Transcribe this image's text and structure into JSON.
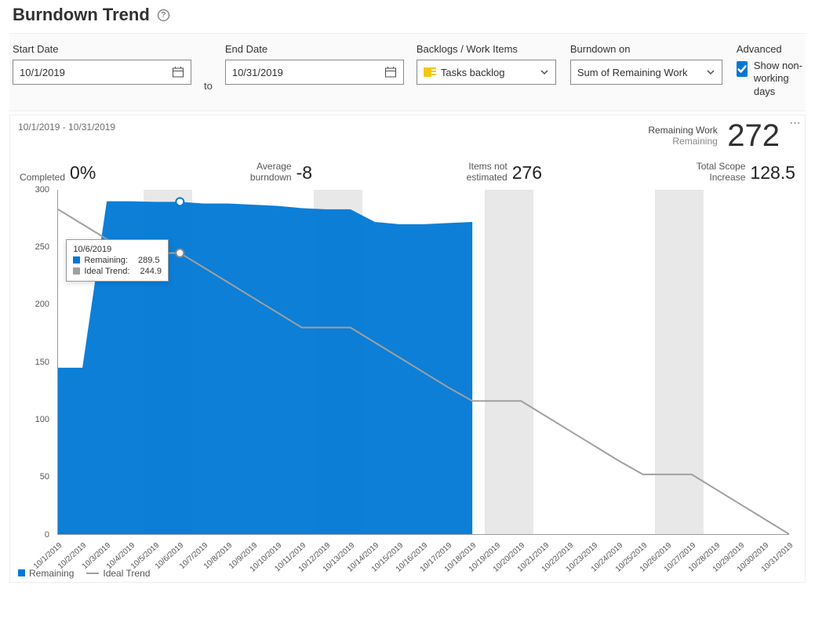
{
  "header": {
    "title": "Burndown Trend"
  },
  "controls": {
    "start_label": "Start Date",
    "start_value": "10/1/2019",
    "to_label": "to",
    "end_label": "End Date",
    "end_value": "10/31/2019",
    "backlogs_label": "Backlogs / Work Items",
    "backlogs_value": "Tasks backlog",
    "burndown_label": "Burndown on",
    "burndown_value": "Sum of Remaining Work",
    "advanced_label": "Advanced",
    "show_nonworking_label": "Show non-working days"
  },
  "chart_header": {
    "range_text": "10/1/2019 - 10/31/2019",
    "remaining_work_label": "Remaining Work",
    "remaining_sub": "Remaining",
    "remaining_value": "272"
  },
  "kpis": {
    "completed_label": "Completed",
    "completed_value": "0%",
    "avg_label1": "Average",
    "avg_label2": "burndown",
    "avg_value": "-8",
    "items_label1": "Items not",
    "items_label2": "estimated",
    "items_value": "276",
    "scope_label1": "Total Scope",
    "scope_label2": "Increase",
    "scope_value": "128.5"
  },
  "legend": {
    "remaining": "Remaining",
    "ideal": "Ideal Trend"
  },
  "tooltip": {
    "date": "10/6/2019",
    "remaining_label": "Remaining:",
    "remaining_value": "289.5",
    "ideal_label": "Ideal Trend:",
    "ideal_value": "244.9"
  },
  "chart_data": {
    "type": "area",
    "title": "Burndown Trend",
    "ylabel": "",
    "ylim": [
      0,
      300
    ],
    "y_ticks": [
      0,
      50,
      100,
      150,
      200,
      250,
      300
    ],
    "categories": [
      "10/1/2019",
      "10/2/2019",
      "10/3/2019",
      "10/4/2019",
      "10/5/2019",
      "10/6/2019",
      "10/7/2019",
      "10/8/2019",
      "10/9/2019",
      "10/10/2019",
      "10/11/2019",
      "10/12/2019",
      "10/13/2019",
      "10/14/2019",
      "10/15/2019",
      "10/16/2019",
      "10/17/2019",
      "10/18/2019",
      "10/19/2019",
      "10/20/2019",
      "10/21/2019",
      "10/22/2019",
      "10/23/2019",
      "10/24/2019",
      "10/25/2019",
      "10/26/2019",
      "10/27/2019",
      "10/28/2019",
      "10/29/2019",
      "10/30/2019",
      "10/31/2019"
    ],
    "weekend_indices": [
      [
        4,
        5
      ],
      [
        11,
        12
      ],
      [
        18,
        19
      ],
      [
        25,
        26
      ]
    ],
    "series": [
      {
        "name": "Remaining",
        "type": "area",
        "color": "#0078d4",
        "values": [
          145,
          145,
          290,
          290,
          289.5,
          289.5,
          288,
          288,
          287,
          286,
          284,
          283,
          283,
          272,
          270,
          270,
          271,
          272,
          null,
          null,
          null,
          null,
          null,
          null,
          null,
          null,
          null,
          null,
          null,
          null,
          null
        ]
      },
      {
        "name": "Ideal Trend",
        "type": "line",
        "color": "#a0a0a0",
        "values": [
          283,
          270,
          257,
          244.9,
          244.9,
          244.9,
          232,
          219,
          206,
          193,
          180,
          180,
          180,
          167,
          154,
          141,
          128,
          116,
          116,
          116,
          103,
          90,
          77,
          64,
          52,
          52,
          52,
          39,
          26,
          13,
          0
        ]
      }
    ],
    "highlight_index": 5
  }
}
